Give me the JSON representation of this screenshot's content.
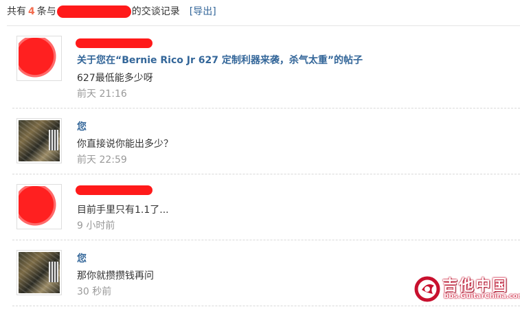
{
  "header": {
    "prefix": "共有",
    "count": "4",
    "mid": "条与",
    "suffix": "的交谈记录",
    "export_label": "[导出]"
  },
  "messages": [
    {
      "author": "",
      "author_redacted": true,
      "subject": "关于您在“Bernie Rico Jr 627 定制利器来袭，杀气太重”的帖子",
      "body": "627最低能多少呀",
      "time": "前天 21:16"
    },
    {
      "author": "您",
      "author_redacted": false,
      "body": "你直接说你能出多少？",
      "time": "前天 22:59"
    },
    {
      "author": "",
      "author_redacted": true,
      "body": "目前手里只有1.1了...",
      "time": "9 小时前"
    },
    {
      "author": "您",
      "author_redacted": false,
      "body": "那你就攒攒钱再问",
      "time": "30 秒前"
    }
  ],
  "watermark": {
    "title": "吉他中国",
    "url": "bbs.GuitarChina.com"
  },
  "colors": {
    "link": "#336699",
    "count": "#f26c4f",
    "muted": "#999999",
    "redaction": "#ff1a1a",
    "brand": "#c8102e"
  }
}
